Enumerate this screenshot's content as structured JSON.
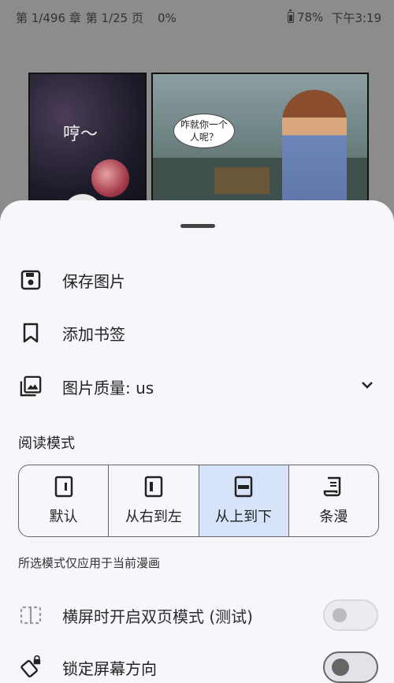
{
  "status_bar": {
    "chapter": "第 1/496 章",
    "page": "第 1/25 页",
    "progress": "0%",
    "battery": "78%",
    "time": "下午3:19"
  },
  "comic": {
    "sfx_text": "哼～",
    "speech_bubble": "咋就你一个人呢？"
  },
  "menu": {
    "save_image": "保存图片",
    "add_bookmark": "添加书签",
    "image_quality": "图片质量: us"
  },
  "reading_mode": {
    "title": "阅读模式",
    "options": [
      "默认",
      "从右到左",
      "从上到下",
      "条漫"
    ],
    "selected_index": 2,
    "hint": "所选模式仅应用于当前漫画"
  },
  "settings": {
    "dual_page_label": "横屏时开启双页模式 (测试)",
    "dual_page_enabled": false,
    "lock_orientation_label": "锁定屏幕方向",
    "lock_orientation_enabled": false
  },
  "colors": {
    "sheet_bg": "#f7f7fb",
    "selected_bg": "#d7e3f8",
    "scrim": "#8c8c8c"
  }
}
